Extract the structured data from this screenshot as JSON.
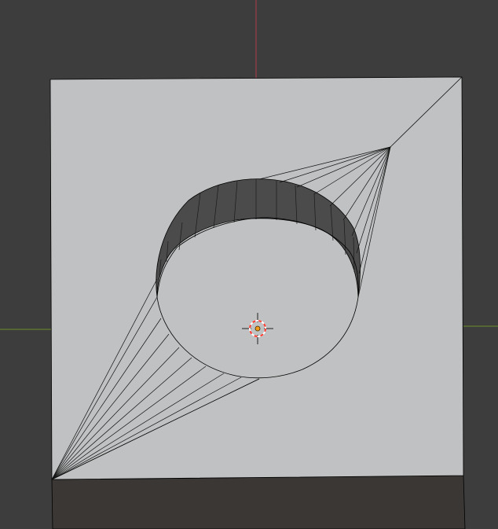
{
  "viewport": {
    "name": "3d-viewport",
    "background_color": "#3d3d3d",
    "axis_colors": {
      "z_axis": "#b23a4a",
      "y_axis": "#6a8f2a"
    },
    "mesh": {
      "top_face_color": "#bfc1c2",
      "side_face_color": "#3a3735",
      "hole_wall_color": "#4a4a4a",
      "edge_color": "#000000"
    },
    "object_origin": {
      "icon": "3d-cursor-icon",
      "cursor_ring_colors": [
        "#ff3b30",
        "#ffffff"
      ],
      "origin_dot_color": "#f29a1a"
    }
  }
}
